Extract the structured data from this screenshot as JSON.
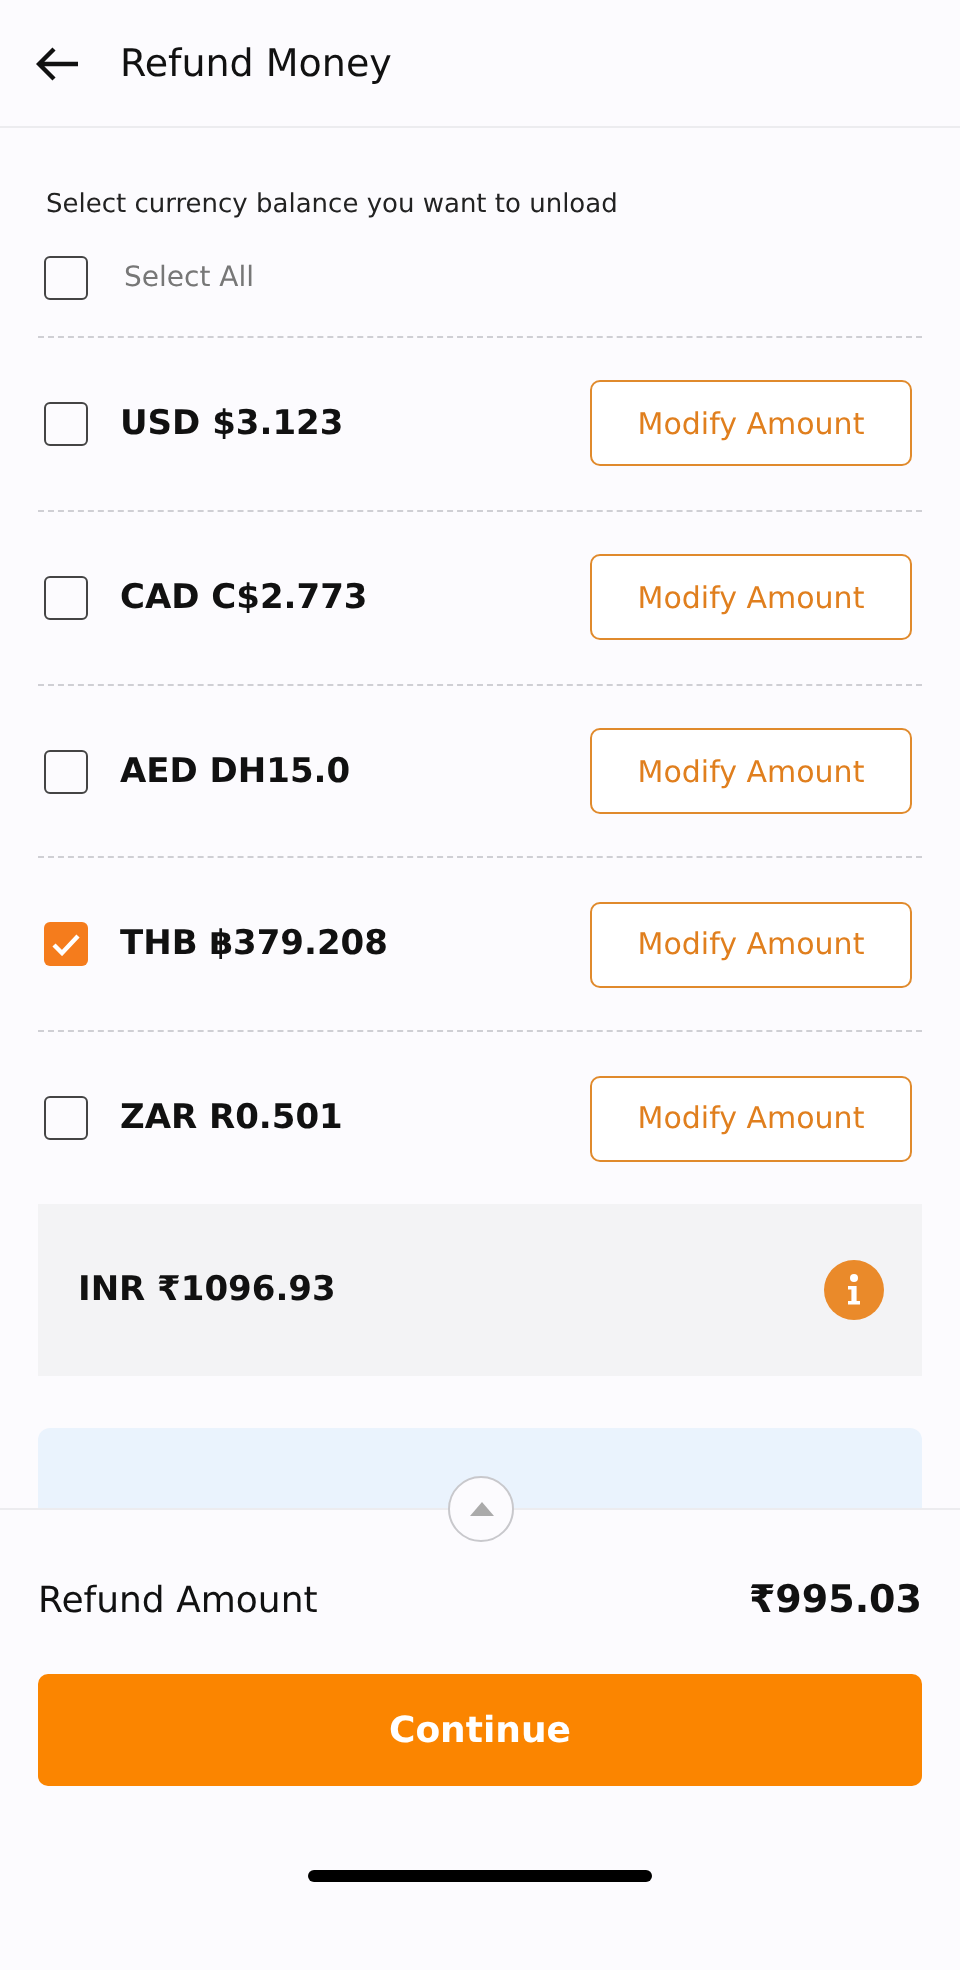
{
  "header": {
    "title": "Refund Money"
  },
  "instruction": "Select currency balance you want to unload",
  "select_all": {
    "label": "Select All",
    "checked": false
  },
  "currencies": [
    {
      "label": "USD $3.123",
      "checked": false,
      "button": "Modify Amount"
    },
    {
      "label": "CAD C$2.773",
      "checked": false,
      "button": "Modify Amount"
    },
    {
      "label": "AED DH15.0",
      "checked": false,
      "button": "Modify Amount"
    },
    {
      "label": "THB ฿379.208",
      "checked": true,
      "button": "Modify Amount"
    },
    {
      "label": "ZAR R0.501",
      "checked": false,
      "button": "Modify Amount"
    }
  ],
  "inr_balance": {
    "label": "INR ₹1096.93"
  },
  "footer": {
    "refund_label": "Refund Amount",
    "refund_value": "₹995.03",
    "continue": "Continue"
  }
}
